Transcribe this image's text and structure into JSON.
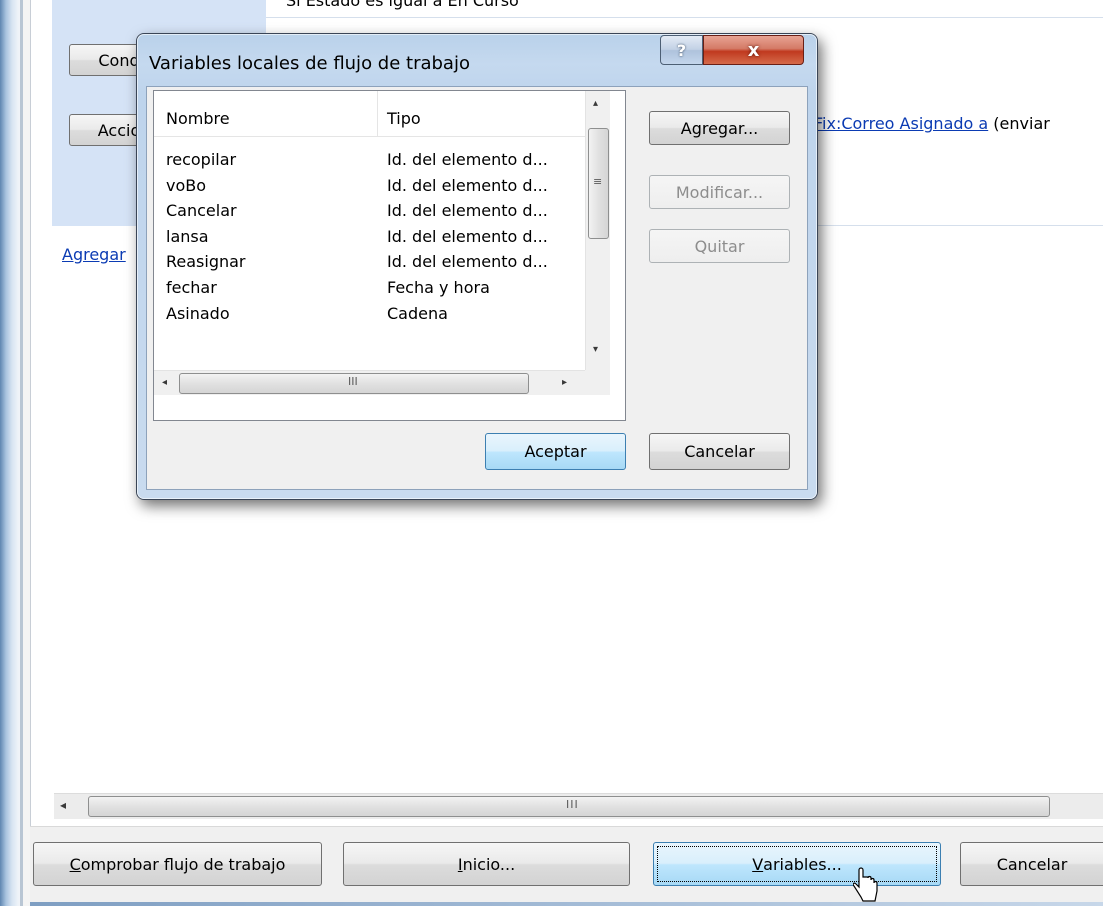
{
  "background": {
    "condition_button_label": "Cond",
    "action_button_label": "Accio",
    "condition_text": "Si Estado es igual a En Curso",
    "action_prefix": "",
    "action_link_1": "Fix:Correo Asignado a",
    "action_suffix": " (enviar",
    "add_link_label": "Agregar"
  },
  "dialog": {
    "title": "Variables locales de flujo de trabajo",
    "help_glyph": "?",
    "close_glyph": "x",
    "columns": [
      "Nombre",
      "Tipo"
    ],
    "rows": [
      {
        "name": "recopilar",
        "type": "Id. del elemento d..."
      },
      {
        "name": "voBo",
        "type": "Id. del elemento d..."
      },
      {
        "name": "Cancelar",
        "type": "Id. del elemento d..."
      },
      {
        "name": "lansa",
        "type": "Id. del elemento d..."
      },
      {
        "name": "Reasignar",
        "type": "Id. del elemento d..."
      },
      {
        "name": "fechar",
        "type": "Fecha y hora"
      },
      {
        "name": "Asinado",
        "type": "Cadena"
      }
    ],
    "buttons": {
      "add": "Agregar...",
      "modify": "Modificar...",
      "remove": "Quitar",
      "ok": "Aceptar",
      "cancel": "Cancelar"
    }
  },
  "footer": {
    "check_workflow_mnemonic": "C",
    "check_workflow_rest": "omprobar flujo de trabajo",
    "start_mnemonic": "I",
    "start_rest": "nicio...",
    "variables_mnemonic": "V",
    "variables_rest": "ariables...",
    "cancel": "Cancelar"
  },
  "scroll_glyphs": {
    "left": "◂",
    "right": "▸",
    "up": "▴",
    "down": "▾",
    "grip_h": "III",
    "grip_v": "≡"
  },
  "colors": {
    "link": "#0b3bb3",
    "rule_highlight": "#d5e3f6",
    "dialog_frame": "#c5d9ef",
    "close_red": "#c0391f"
  }
}
